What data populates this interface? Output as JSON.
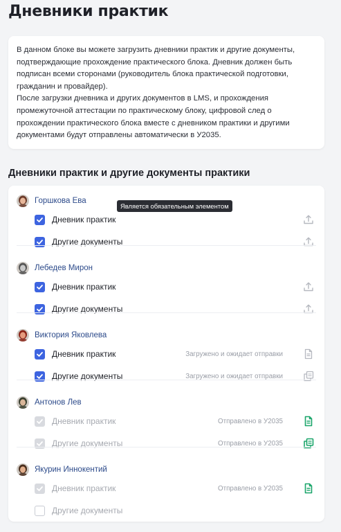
{
  "page": {
    "title": "Дневники практик"
  },
  "info": {
    "text_lines": [
      "В данном блоке вы можете загрузить дневники практик и другие документы,",
      "подтверждающие прохождение практического блока. Дневник должен быть",
      "подписан всеми сторонами (руководитель блока практической подготовки,",
      "гражданин и провайдер).",
      "После загрузки дневника и других документов в LMS, и прохождения",
      "промежуточной аттестации по практическому блоку, цифровой след о",
      "прохождении практического блока вместе с дневником практики и другими",
      "документами будут отправлены автоматически в У2035."
    ]
  },
  "section": {
    "title": "Дневники практик и другие документы практики"
  },
  "tooltip": {
    "text": "Является обязательным элементом"
  },
  "colors": {
    "accent": "#3d64e0",
    "link": "#2c4a8a",
    "sent": "#1aa56a",
    "muted_icon": "#b5b8bf"
  },
  "people": [
    {
      "name": "Горшкова Ева",
      "avatar": "avatar-woman",
      "items": [
        {
          "label": "Дневник практик",
          "state": "checked",
          "status": "",
          "icon": "upload-icon"
        },
        {
          "label": "Другие документы",
          "state": "checked",
          "status": "",
          "icon": "upload-icon"
        }
      ]
    },
    {
      "name": "Лебедев Мирон",
      "avatar": "avatar-man-gray",
      "items": [
        {
          "label": "Дневник практик",
          "state": "checked",
          "status": "",
          "icon": "upload-icon"
        },
        {
          "label": "Другие документы",
          "state": "checked",
          "status": "",
          "icon": "upload-icon"
        }
      ]
    },
    {
      "name": "Виктория Яковлева",
      "avatar": "avatar-woman-red",
      "items": [
        {
          "label": "Дневник практик",
          "state": "checked",
          "status": "Загружено и ожидает отправки",
          "icon": "document-icon"
        },
        {
          "label": "Другие документы",
          "state": "checked",
          "status": "Загружено и ожидает отправки",
          "icon": "documents-icon"
        }
      ]
    },
    {
      "name": "Антонов Лев",
      "avatar": "avatar-man",
      "items": [
        {
          "label": "Дневник практик",
          "state": "disabled",
          "status": "Отправлено в У2035",
          "icon": "document-sent-icon"
        },
        {
          "label": "Другие документы",
          "state": "disabled",
          "status": "Отправлено в У2035",
          "icon": "documents-sent-icon"
        }
      ]
    },
    {
      "name": "Якурин Иннокентий",
      "avatar": "avatar-man-2",
      "items": [
        {
          "label": "Дневник практик",
          "state": "disabled",
          "status": "Отправлено в У2035",
          "icon": "document-sent-icon"
        },
        {
          "label": "Другие документы",
          "state": "empty",
          "status": "",
          "icon": ""
        }
      ]
    }
  ]
}
